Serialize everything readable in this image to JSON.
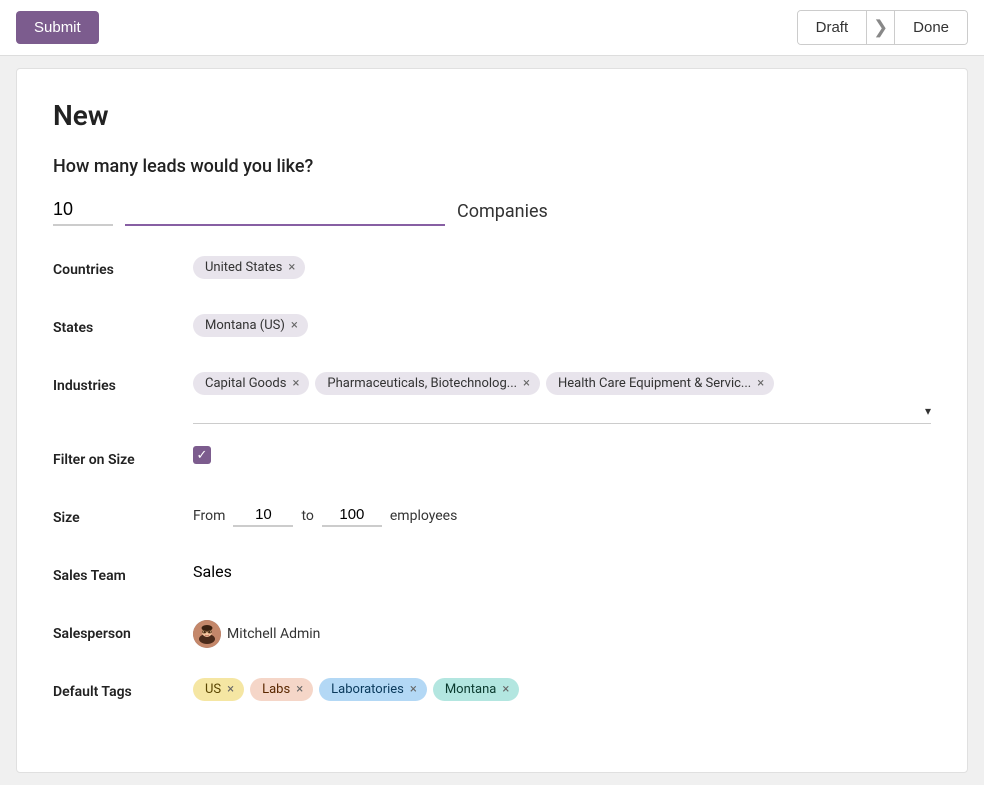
{
  "header": {
    "submit_label": "Submit",
    "status_draft": "Draft",
    "status_done": "Done"
  },
  "page": {
    "title": "New",
    "question": "How many leads would you like?",
    "leads_count": "10",
    "leads_unit": "Companies"
  },
  "fields": {
    "countries_label": "Countries",
    "states_label": "States",
    "industries_label": "Industries",
    "filter_on_size_label": "Filter on Size",
    "size_label": "Size",
    "size_from_label": "From",
    "size_from_value": "10",
    "size_to_label": "to",
    "size_to_value": "100",
    "size_unit": "employees",
    "sales_team_label": "Sales Team",
    "sales_team_value": "Sales",
    "salesperson_label": "Salesperson",
    "salesperson_name": "Mitchell Admin",
    "default_tags_label": "Default Tags"
  },
  "tags": {
    "countries": [
      {
        "label": "United States",
        "id": "us"
      }
    ],
    "states": [
      {
        "label": "Montana (US)",
        "id": "montana"
      }
    ],
    "industries": [
      {
        "label": "Capital Goods",
        "id": "capital"
      },
      {
        "label": "Pharmaceuticals, Biotechnolog...",
        "id": "pharma"
      },
      {
        "label": "Health Care Equipment & Servic...",
        "id": "health"
      }
    ],
    "default_tags": [
      {
        "label": "US",
        "style": "yellow"
      },
      {
        "label": "Labs",
        "style": "peach"
      },
      {
        "label": "Laboratories",
        "style": "blue"
      },
      {
        "label": "Montana",
        "style": "teal"
      }
    ]
  },
  "icons": {
    "chevron_down": "▾",
    "check": "✓",
    "close": "×",
    "arrow_right": "❯"
  }
}
